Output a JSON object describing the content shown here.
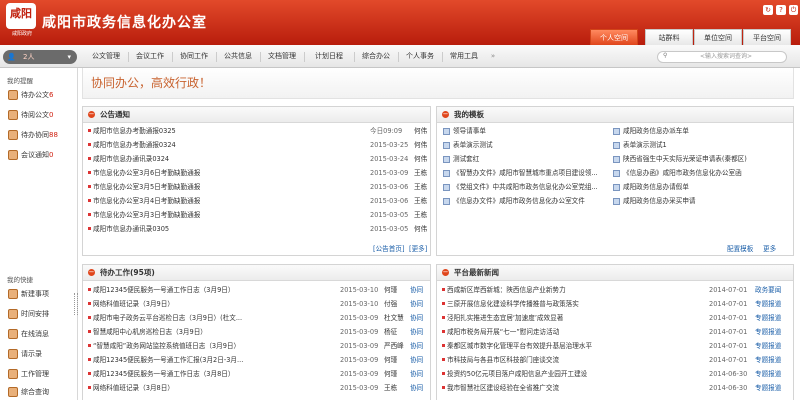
{
  "header": {
    "logo_text": "咸阳",
    "logo_sub": "咸阳政府",
    "title": "咸阳市政务信息化办公室",
    "icons": [
      "refresh-icon",
      "help-icon",
      "power-icon"
    ]
  },
  "top_tabs": [
    "个人空间",
    "站群料",
    "单位空间",
    "平台空间"
  ],
  "nav": {
    "user_label": "2人",
    "items": [
      "公文管理",
      "会议工作",
      "协同工作",
      "公共信息",
      "文档管理",
      "计划日程",
      "综合办公",
      "个人事务",
      "常用工具",
      "»"
    ],
    "search_placeholder": "<输入搜索词查询>"
  },
  "sidebar": {
    "reminders_title": "我的提醒",
    "reminders": [
      {
        "label": "待办公文",
        "count": "6"
      },
      {
        "label": "待阅公文",
        "count": "0"
      },
      {
        "label": "待办协同",
        "count": "88"
      },
      {
        "label": "会议通知",
        "count": "0"
      }
    ],
    "shortcuts_title": "我的快捷",
    "shortcuts": [
      "新建事项",
      "时间安排",
      "在线消息",
      "请示录",
      "工作管理",
      "综合查询"
    ]
  },
  "slogan": "协同办公，高效行政！",
  "notice_panel": {
    "title": "公告通知",
    "rows": [
      {
        "title": "咸阳市信息办考勤通报0325",
        "date": "今日09:09",
        "author": "何伟"
      },
      {
        "title": "咸阳市信息办考勤通报0324",
        "date": "2015-03-25",
        "author": "何伟"
      },
      {
        "title": "咸阳市信息办通讯录0324",
        "date": "2015-03-24",
        "author": "何伟"
      },
      {
        "title": "市信息化办公室3月6日考勤缺勤通报",
        "date": "2015-03-09",
        "author": "王栋"
      },
      {
        "title": "市信息化办公室3月5日考勤缺勤通报",
        "date": "2015-03-06",
        "author": "王栋"
      },
      {
        "title": "市信息化办公室3月4日考勤缺勤通报",
        "date": "2015-03-06",
        "author": "王栋"
      },
      {
        "title": "市信息化办公室3月3日考勤缺勤通报",
        "date": "2015-03-05",
        "author": "王栋"
      },
      {
        "title": "咸阳市信息办通讯录0305",
        "date": "2015-03-05",
        "author": "何伟"
      }
    ],
    "footer": [
      "[公告首页]",
      "[更多]"
    ]
  },
  "template_panel": {
    "title": "我的模板",
    "left": [
      "领导请事单",
      "表单演示测试",
      "测试套红",
      "《智慧办文件》咸阳市智慧城市重点项目建设领...",
      "《党组文件》中共咸阳市政务信息化办公室党组...",
      "《信息办文件》咸阳市政务信息化办公室文件"
    ],
    "right": [
      "咸阳政务信息办派车单",
      "表单演示测试1",
      "陕西省强生中天实际光荣证申请表(秦都区)",
      "《信息办函》咸阳市政务信息化办公室函",
      "咸阳政务信息办请假单",
      "咸阳政务信息办采买申请"
    ],
    "footer": [
      "配置模板",
      "更多"
    ]
  },
  "todo_panel": {
    "title": "待办工作(95项)",
    "rows": [
      {
        "title": "咸阳12345便民服务一号通工作日志（3月9日）",
        "date": "2015-03-10",
        "author": "何瑾",
        "status": "协同"
      },
      {
        "title": "网络科值班记录（3月9日）",
        "date": "2015-03-10",
        "author": "付强",
        "status": "协同"
      },
      {
        "title": "咸阳市电子政务云平台巡检日志（3月9日）(杜文...",
        "date": "2015-03-09",
        "author": "杜文慧",
        "status": "协同"
      },
      {
        "title": "智慧咸阳中心机房巡检日志（3月9日）",
        "date": "2015-03-09",
        "author": "杨征",
        "status": "协同"
      },
      {
        "title": "“智慧咸阳”政务网站监控系统值班日志（3月9日）",
        "date": "2015-03-09",
        "author": "严西峰",
        "status": "协同"
      },
      {
        "title": "咸阳12345便民服务一号通工作汇报(3月2日-3月...",
        "date": "2015-03-09",
        "author": "何瑾",
        "status": "协同"
      },
      {
        "title": "咸阳12345便民服务一号通工作日志（3月8日）",
        "date": "2015-03-09",
        "author": "何瑾",
        "status": "协同"
      },
      {
        "title": "网络科值班记录（3月8日）",
        "date": "2015-03-09",
        "author": "王栋",
        "status": "协同"
      }
    ]
  },
  "news_panel": {
    "title": "平台最新新闻",
    "rows": [
      {
        "title": "西咸新区岸西新城：陕西信息产业新势力",
        "date": "2014-07-01",
        "category": "政务要闻"
      },
      {
        "title": "三原开展信息化建设科学传播推普与政策落实",
        "date": "2014-07-01",
        "category": "专题报道"
      },
      {
        "title": "泾阳扎实推进生态宜居‘加速度’成效显著",
        "date": "2014-07-01",
        "category": "专题报道"
      },
      {
        "title": "咸阳市税务局开展“七一”慰问走访活动",
        "date": "2014-07-01",
        "category": "专题报道"
      },
      {
        "title": "秦都区城市数字化管理平台有效提升基层治理水平",
        "date": "2014-07-01",
        "category": "专题报道"
      },
      {
        "title": "市科技局与各县市区科技部门座谈交流",
        "date": "2014-07-01",
        "category": "专题报道"
      },
      {
        "title": "投资约50亿元项目落户咸阳信息产业园开工建设",
        "date": "2014-06-30",
        "category": "专题报道"
      },
      {
        "title": "我市智慧社区建设经验在全省推广交流",
        "date": "2014-06-30",
        "category": "专题报道"
      }
    ]
  }
}
